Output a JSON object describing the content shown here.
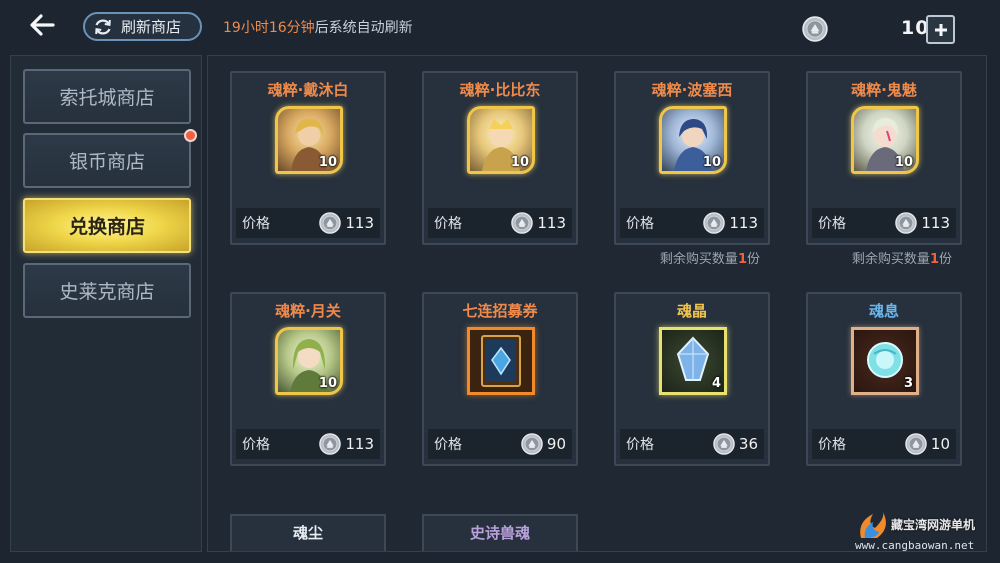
{
  "header": {
    "refresh_label": "刷新商店",
    "timer_highlight": "19小时16分钟",
    "timer_suffix": "后系统自动刷新",
    "currency_count": "10"
  },
  "sidebar": {
    "tabs": [
      {
        "label": "索托城商店",
        "active": false,
        "badge": false
      },
      {
        "label": "银币商店",
        "active": false,
        "badge": true
      },
      {
        "label": "兑换商店",
        "active": true,
        "badge": false
      },
      {
        "label": "史莱克商店",
        "active": false,
        "badge": false
      }
    ]
  },
  "shop": {
    "price_label": "价格",
    "items": [
      {
        "name": "魂粹·戴沐白",
        "qty": "10",
        "price": "113",
        "kind": "hero",
        "color": "#f08a4b"
      },
      {
        "name": "魂粹·比比东",
        "qty": "10",
        "price": "113",
        "kind": "hero",
        "color": "#f08a4b"
      },
      {
        "name": "魂粹·波塞西",
        "qty": "10",
        "price": "113",
        "kind": "hero",
        "color": "#f08a4b",
        "remain_prefix": "剩余购买数量",
        "remain_num": "1",
        "remain_suffix": "份"
      },
      {
        "name": "魂粹·鬼魅",
        "qty": "10",
        "price": "113",
        "kind": "hero",
        "color": "#f08a4b",
        "remain_prefix": "剩余购买数量",
        "remain_num": "1",
        "remain_suffix": "份"
      },
      {
        "name": "魂粹·月关",
        "qty": "10",
        "price": "113",
        "kind": "hero",
        "color": "#f08a4b"
      },
      {
        "name": "七连招募券",
        "qty": "",
        "price": "90",
        "kind": "ticket",
        "color": "#f08a4b"
      },
      {
        "name": "魂晶",
        "qty": "4",
        "price": "36",
        "kind": "crystal",
        "color": "#f3c44b"
      },
      {
        "name": "魂息",
        "qty": "3",
        "price": "10",
        "kind": "breath",
        "color": "#6ab6ea"
      }
    ],
    "partial_items": [
      {
        "name": "魂尘"
      },
      {
        "name": "史诗兽魂"
      }
    ]
  },
  "watermark": {
    "name": "藏宝湾网游单机",
    "url": "www.cangbaowan.net"
  },
  "colors": {
    "accent_orange": "#f08a4b",
    "active_tab": "#f0d74a",
    "badge_red": "#f0613f",
    "remain_red": "#f0613f"
  },
  "icons": {
    "back": "arrow-left-icon",
    "refresh": "refresh-icon",
    "currency": "silver-coin-icon",
    "plus": "plus-icon"
  }
}
